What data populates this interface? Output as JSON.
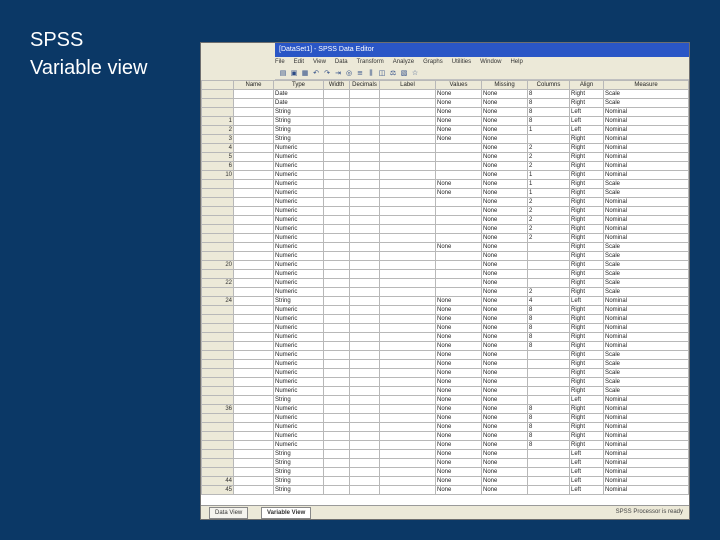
{
  "slide": {
    "title_line1": "SPSS",
    "title_line2": "Variable view"
  },
  "window": {
    "title": "[DataSet1] - SPSS Data Editor"
  },
  "menu": [
    "File",
    "Edit",
    "View",
    "Data",
    "Transform",
    "Analyze",
    "Graphs",
    "Utilities",
    "Window",
    "Help"
  ],
  "toolbar": [
    "open-icon",
    "save-icon",
    "print-icon",
    "undo-icon",
    "redo-icon",
    "goto-icon",
    "find-icon",
    "insert-case-icon",
    "insert-variable-icon",
    "split-icon",
    "weight-icon",
    "select-icon",
    "labels-icon"
  ],
  "grid": {
    "headers": [
      "Name",
      "Type",
      "Width",
      "Decimals",
      "Label",
      "Values",
      "Missing",
      "Columns",
      "Align",
      "Measure"
    ],
    "rows": [
      [
        "",
        "",
        "Date",
        "",
        "",
        "",
        "None",
        "None",
        "8",
        "Right",
        "Scale"
      ],
      [
        "",
        "",
        "Date",
        "",
        "",
        "",
        "None",
        "None",
        "8",
        "Right",
        "Scale"
      ],
      [
        "",
        "",
        "String",
        "",
        "",
        "",
        "None",
        "None",
        "8",
        "Left",
        "Nominal"
      ],
      [
        "1",
        "",
        "String",
        "",
        "",
        "",
        "None",
        "None",
        "8",
        "Left",
        "Nominal"
      ],
      [
        "2",
        "",
        "String",
        "",
        "",
        "",
        "None",
        "None",
        "1",
        "Left",
        "Nominal"
      ],
      [
        "3",
        "",
        "String",
        "",
        "",
        "",
        "None",
        "None",
        "",
        "Right",
        "Nominal"
      ],
      [
        "4",
        "",
        "Numeric",
        "",
        "",
        "",
        "",
        "None",
        "2",
        "Right",
        "Nominal"
      ],
      [
        "5",
        "",
        "Numeric",
        "",
        "",
        "",
        "",
        "None",
        "2",
        "Right",
        "Nominal"
      ],
      [
        "6",
        "",
        "Numeric",
        "",
        "",
        "",
        "",
        "None",
        "2",
        "Right",
        "Nominal"
      ],
      [
        "10",
        "",
        "Numeric",
        "",
        "",
        "",
        "",
        "None",
        "1",
        "Right",
        "Nominal"
      ],
      [
        "",
        "",
        "Numeric",
        "",
        "",
        "",
        "None",
        "None",
        "1",
        "Right",
        "Scale"
      ],
      [
        "",
        "",
        "Numeric",
        "",
        "",
        "",
        "None",
        "None",
        "1",
        "Right",
        "Scale"
      ],
      [
        "",
        "",
        "Numeric",
        "",
        "",
        "",
        "",
        "None",
        "2",
        "Right",
        "Nominal"
      ],
      [
        "",
        "",
        "Numeric",
        "",
        "",
        "",
        "",
        "None",
        "2",
        "Right",
        "Nominal"
      ],
      [
        "",
        "",
        "Numeric",
        "",
        "",
        "",
        "",
        "None",
        "2",
        "Right",
        "Nominal"
      ],
      [
        "",
        "",
        "Numeric",
        "",
        "",
        "",
        "",
        "None",
        "2",
        "Right",
        "Nominal"
      ],
      [
        "",
        "",
        "Numeric",
        "",
        "",
        "",
        "",
        "None",
        "2",
        "Right",
        "Nominal"
      ],
      [
        "",
        "",
        "Numeric",
        "",
        "",
        "",
        "None",
        "None",
        "",
        "Right",
        "Scale"
      ],
      [
        "",
        "",
        "Numeric",
        "",
        "",
        "",
        "",
        "None",
        "",
        "Right",
        "Scale"
      ],
      [
        "20",
        "",
        "Numeric",
        "",
        "",
        "",
        "",
        "None",
        "",
        "Right",
        "Scale"
      ],
      [
        "",
        "",
        "Numeric",
        "",
        "",
        "",
        "",
        "None",
        "",
        "Right",
        "Scale"
      ],
      [
        "22",
        "",
        "Numeric",
        "",
        "",
        "",
        "",
        "None",
        "",
        "Right",
        "Scale"
      ],
      [
        "",
        "",
        "Numeric",
        "",
        "",
        "",
        "",
        "None",
        "2",
        "Right",
        "Scale"
      ],
      [
        "24",
        "",
        "String",
        "",
        "",
        "",
        "None",
        "None",
        "4",
        "Left",
        "Nominal"
      ],
      [
        "",
        "",
        "Numeric",
        "",
        "",
        "",
        "None",
        "None",
        "8",
        "Right",
        "Nominal"
      ],
      [
        "",
        "",
        "Numeric",
        "",
        "",
        "",
        "None",
        "None",
        "8",
        "Right",
        "Nominal"
      ],
      [
        "",
        "",
        "Numeric",
        "",
        "",
        "",
        "None",
        "None",
        "8",
        "Right",
        "Nominal"
      ],
      [
        "",
        "",
        "Numeric",
        "",
        "",
        "",
        "None",
        "None",
        "8",
        "Right",
        "Nominal"
      ],
      [
        "",
        "",
        "Numeric",
        "",
        "",
        "",
        "None",
        "None",
        "8",
        "Right",
        "Nominal"
      ],
      [
        "",
        "",
        "Numeric",
        "",
        "",
        "",
        "None",
        "None",
        "",
        "Right",
        "Scale"
      ],
      [
        "",
        "",
        "Numeric",
        "",
        "",
        "",
        "None",
        "None",
        "",
        "Right",
        "Scale"
      ],
      [
        "",
        "",
        "Numeric",
        "",
        "",
        "",
        "None",
        "None",
        "",
        "Right",
        "Scale"
      ],
      [
        "",
        "",
        "Numeric",
        "",
        "",
        "",
        "None",
        "None",
        "",
        "Right",
        "Scale"
      ],
      [
        "",
        "",
        "Numeric",
        "",
        "",
        "",
        "None",
        "None",
        "",
        "Right",
        "Scale"
      ],
      [
        "",
        "",
        "String",
        "",
        "",
        "",
        "None",
        "None",
        "",
        "Left",
        "Nominal"
      ],
      [
        "36",
        "",
        "Numeric",
        "",
        "",
        "",
        "None",
        "None",
        "8",
        "Right",
        "Nominal"
      ],
      [
        "",
        "",
        "Numeric",
        "",
        "",
        "",
        "None",
        "None",
        "8",
        "Right",
        "Nominal"
      ],
      [
        "",
        "",
        "Numeric",
        "",
        "",
        "",
        "None",
        "None",
        "8",
        "Right",
        "Nominal"
      ],
      [
        "",
        "",
        "Numeric",
        "",
        "",
        "",
        "None",
        "None",
        "8",
        "Right",
        "Nominal"
      ],
      [
        "",
        "",
        "Numeric",
        "",
        "",
        "",
        "None",
        "None",
        "8",
        "Right",
        "Nominal"
      ],
      [
        "",
        "",
        "String",
        "",
        "",
        "",
        "None",
        "None",
        "",
        "Left",
        "Nominal"
      ],
      [
        "",
        "",
        "String",
        "",
        "",
        "",
        "None",
        "None",
        "",
        "Left",
        "Nominal"
      ],
      [
        "",
        "",
        "String",
        "",
        "",
        "",
        "None",
        "None",
        "",
        "Left",
        "Nominal"
      ],
      [
        "44",
        "",
        "String",
        "",
        "",
        "",
        "None",
        "None",
        "",
        "Left",
        "Nominal"
      ],
      [
        "45",
        "",
        "String",
        "",
        "",
        "",
        "None",
        "None",
        "",
        "Left",
        "Nominal"
      ]
    ]
  },
  "tabs": {
    "data_view": "Data View",
    "variable_view": "Variable View"
  },
  "status": "SPSS Processor is ready"
}
